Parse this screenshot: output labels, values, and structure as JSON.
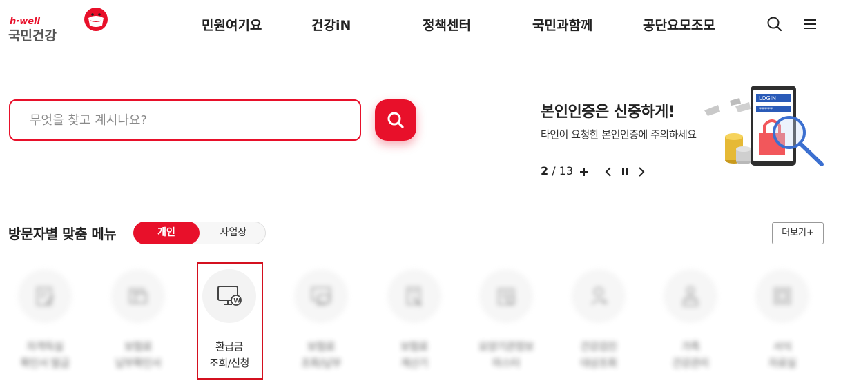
{
  "header": {
    "logo_en": "h·well",
    "logo_ko": "국민건강",
    "nav": [
      {
        "label": "민원여기요"
      },
      {
        "label": "건강iN"
      },
      {
        "label": "정책센터"
      },
      {
        "label": "국민과함께"
      },
      {
        "label": "공단요모조모"
      }
    ],
    "icons": {
      "search": "search-icon",
      "menu": "hamburger-menu-icon"
    }
  },
  "search": {
    "placeholder": "무엇을 찾고 계시나요?",
    "button_icon": "search-icon"
  },
  "banner": {
    "title": "본인인증은 신중하게!",
    "subtitle": "타인이 요청한 본인인증에 주의하세요",
    "current": "2",
    "separator": " / ",
    "total": "13",
    "art_login_text": "LOGIN",
    "art_password_text": "*****"
  },
  "menu_section": {
    "title": "방문자별 맞춤 메뉴",
    "toggle": [
      {
        "label": "개인",
        "active": true
      },
      {
        "label": "사업장",
        "active": false
      }
    ],
    "more_label": "더보기+",
    "items": [
      {
        "label": "자격득실\n확인서 발급",
        "blurred": true,
        "icon": "document-edit-icon"
      },
      {
        "label": "보험료\n납부확인서",
        "blurred": true,
        "icon": "receipt-icon"
      },
      {
        "label": "환급금\n조회/신청",
        "blurred": false,
        "icon": "monitor-won-icon"
      },
      {
        "label": "보험료\n조회/납부",
        "blurred": true,
        "icon": "monitor-card-icon"
      },
      {
        "label": "보험료\n계산기",
        "blurred": true,
        "icon": "calculator-icon"
      },
      {
        "label": "요양기관정보\n마스터",
        "blurred": true,
        "icon": "hospital-icon"
      },
      {
        "label": "건강검진\n대상조회",
        "blurred": true,
        "icon": "health-check-icon"
      },
      {
        "label": "가족\n건강관리",
        "blurred": true,
        "icon": "family-icon"
      },
      {
        "label": "서식\n자료실",
        "blurred": true,
        "icon": "forms-icon"
      }
    ]
  },
  "colors": {
    "brand": "#e8102a",
    "text": "#222222",
    "muted": "#8a8a8a"
  }
}
